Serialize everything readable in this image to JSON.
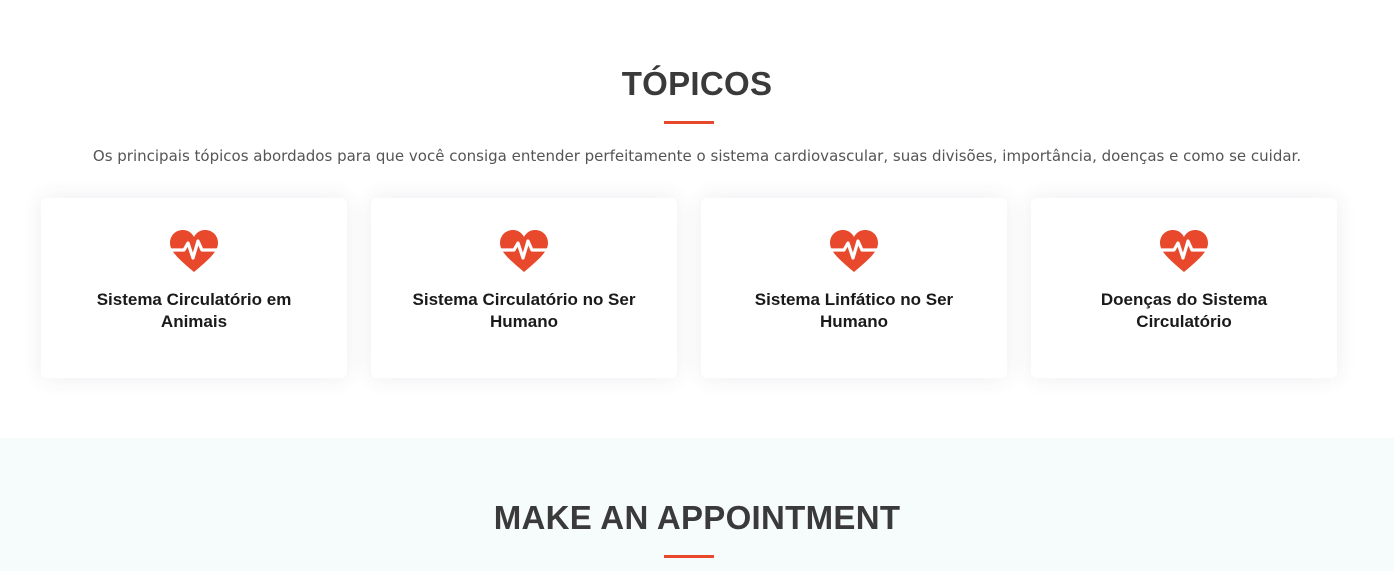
{
  "colors": {
    "accent": "#e8492c",
    "appointment_bg": "#f6fbfb"
  },
  "topics": {
    "title": "TÓPICOS",
    "subtitle": "Os principais tópicos abordados para que você consiga entender perfeitamente o sistema cardiovascular, suas divisões, importância, doenças e como se cuidar.",
    "cards": [
      {
        "icon": "heartbeat-icon",
        "title": "Sistema Circulatório em Animais"
      },
      {
        "icon": "heartbeat-icon",
        "title": "Sistema Circulatório no Ser Humano"
      },
      {
        "icon": "heartbeat-icon",
        "title": "Sistema Linfático no Ser Humano"
      },
      {
        "icon": "heartbeat-icon",
        "title": "Doenças do Sistema Circulatório"
      }
    ]
  },
  "appointment": {
    "title": "MAKE AN APPOINTMENT"
  }
}
